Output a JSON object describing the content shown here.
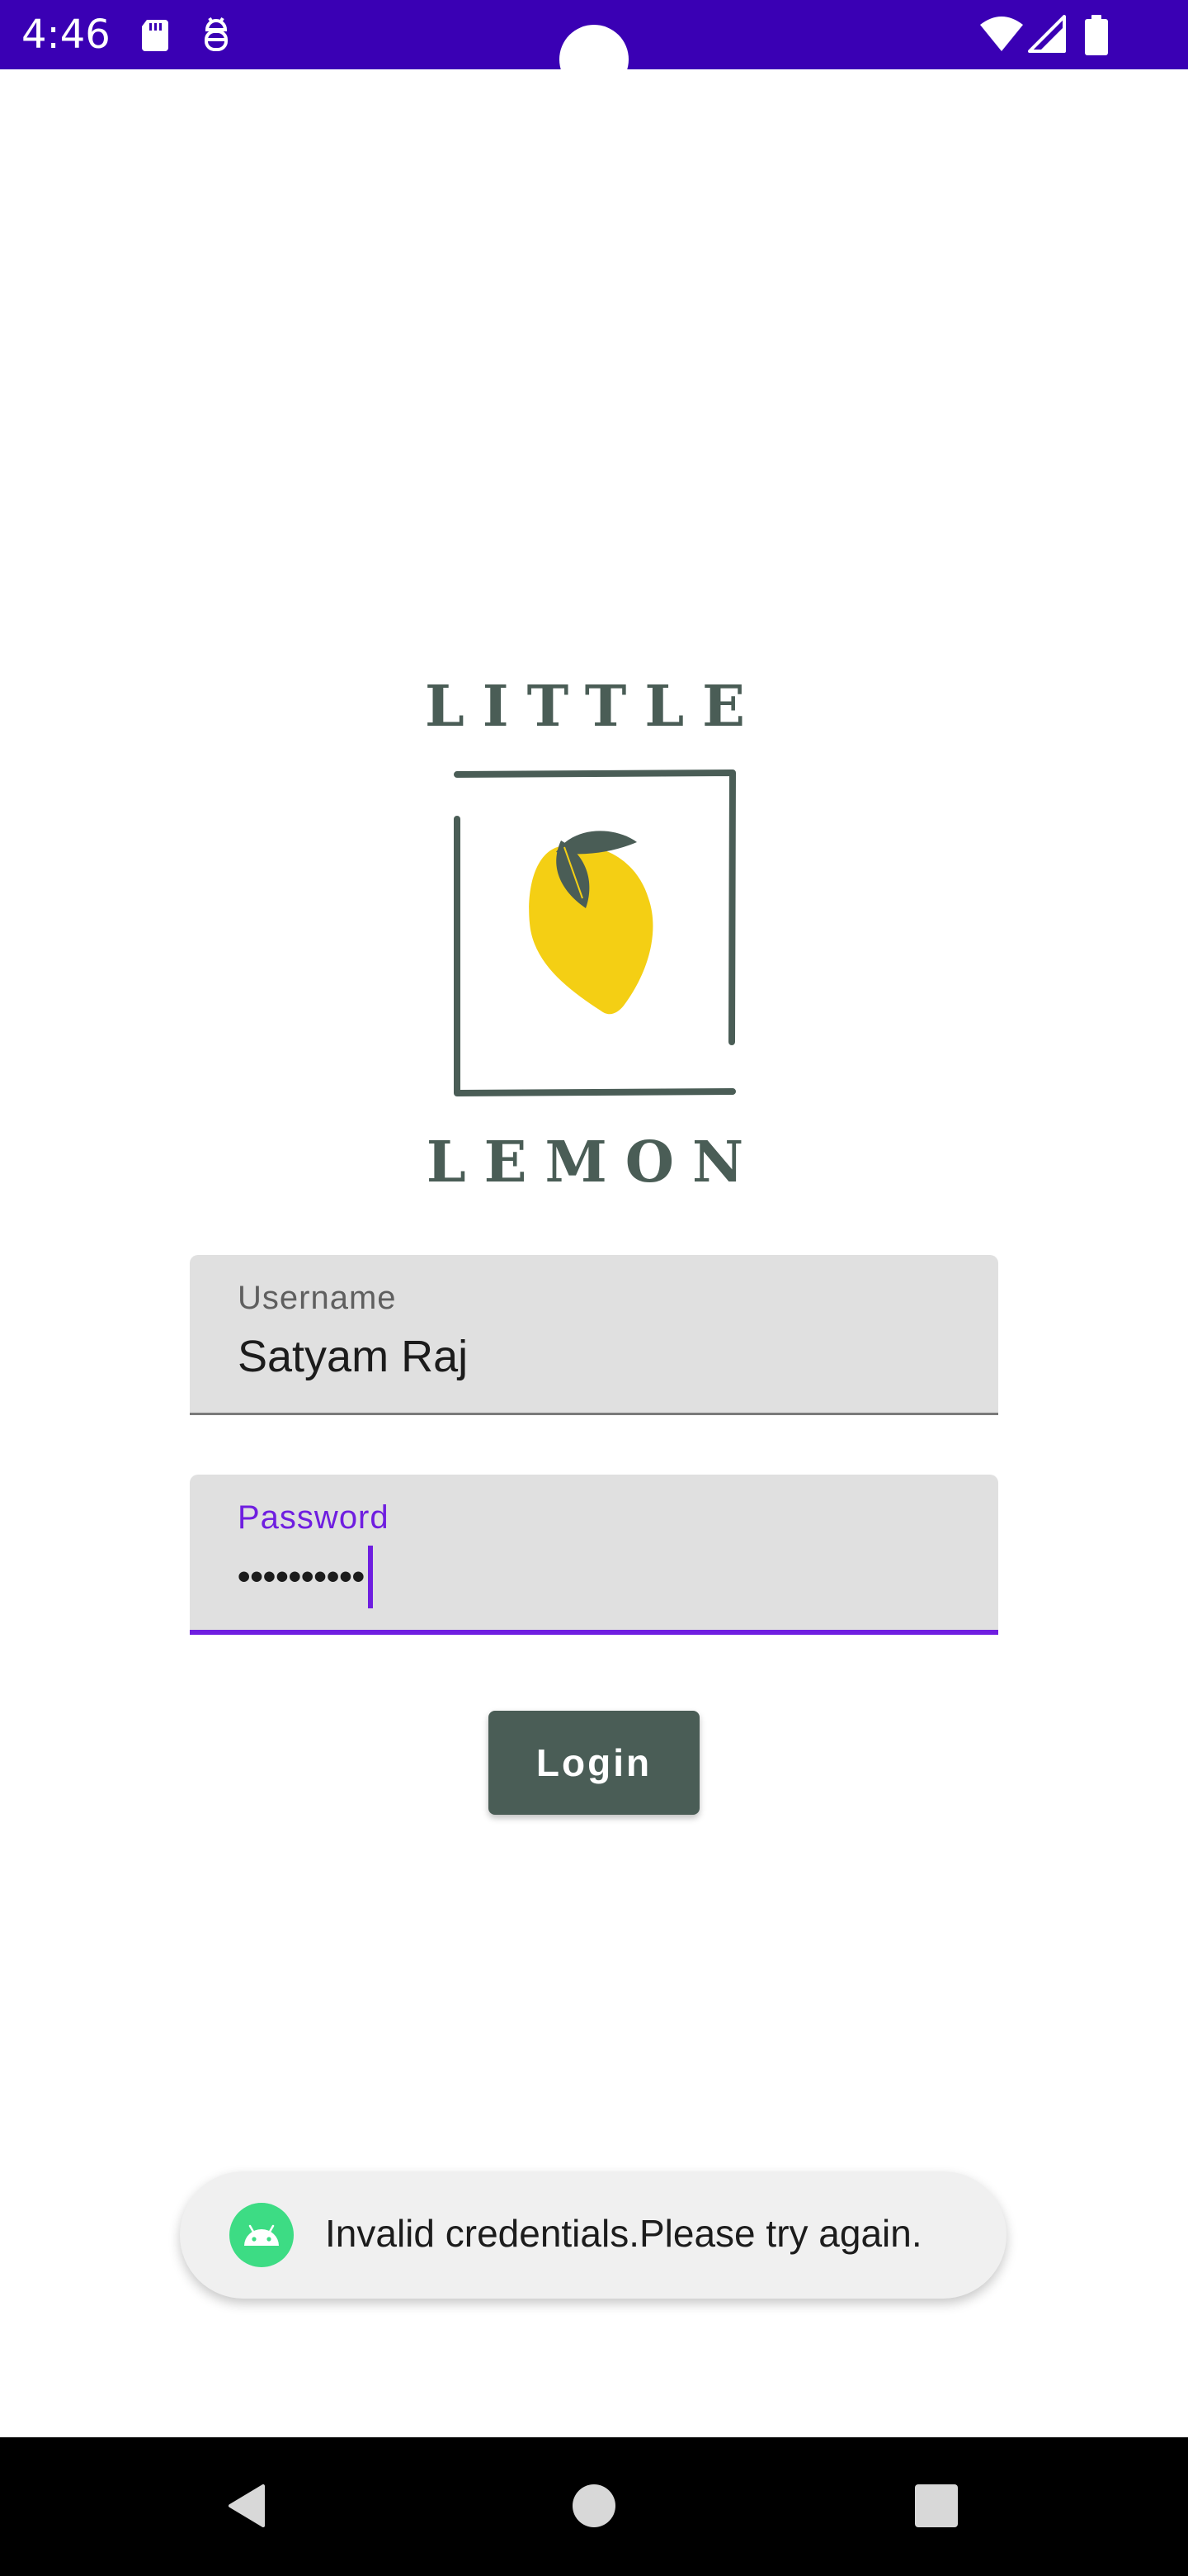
{
  "status_bar": {
    "time": "4:46",
    "left_icons": [
      "sd-card-icon",
      "debug-icon"
    ],
    "right_icons": [
      "wifi-icon",
      "signal-icon",
      "battery-icon"
    ],
    "color": "#3a00b4"
  },
  "logo": {
    "top_text": "LITTLE",
    "bottom_text": "LEMON",
    "color": "#4a5d56",
    "lemon_color": "#f4cf14"
  },
  "form": {
    "username": {
      "label": "Username",
      "value": "Satyam Raj"
    },
    "password": {
      "label": "Password",
      "masked_value": "••••••••••"
    },
    "login_label": "Login",
    "accent_color": "#6f1ee0"
  },
  "toast": {
    "icon": "android-icon",
    "message": "Invalid credentials.Please try again."
  },
  "nav_bar": {
    "buttons": [
      "back-icon",
      "home-icon",
      "recents-icon"
    ]
  }
}
